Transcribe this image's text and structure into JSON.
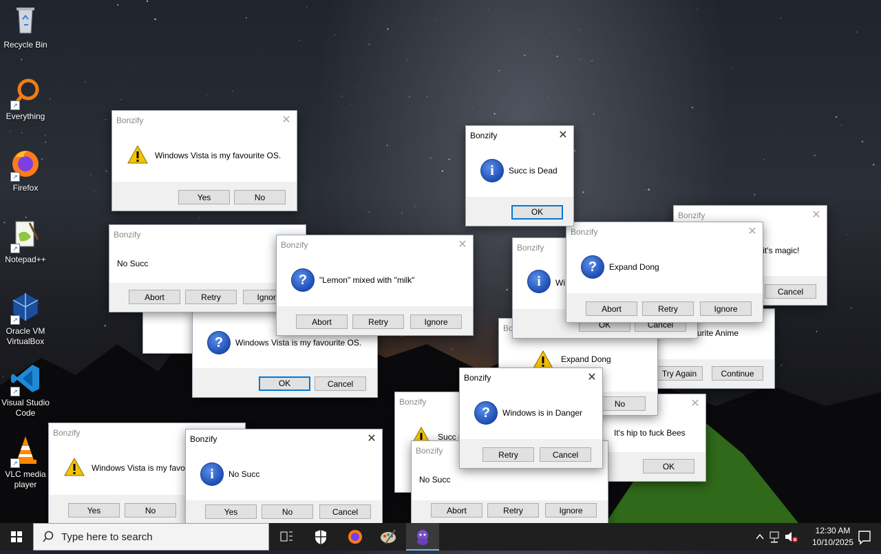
{
  "desktop_icons": [
    {
      "label": "Recycle Bin"
    },
    {
      "label": "Everything"
    },
    {
      "label": "Firefox"
    },
    {
      "label": "Notepad++"
    },
    {
      "label": "Oracle VM VirtualBox"
    },
    {
      "label": "Visual Studio Code"
    },
    {
      "label": "VLC media player"
    }
  ],
  "dialogs": {
    "app_title": "Bonzify",
    "d1": {
      "message": "Windows Vista is my favourite OS.",
      "buttons": [
        "Yes",
        "No"
      ]
    },
    "d2": {
      "message": "Succ is Dead",
      "buttons": [
        "OK"
      ]
    },
    "d3": {
      "message": "l, it's magic!",
      "buttons": [
        "Cancel"
      ]
    },
    "d4": {
      "message": "No Succ",
      "buttons": [
        "Abort",
        "Retry",
        "Ignore"
      ]
    },
    "d5": {
      "message": "\"Lemon\" mixed with \"milk\"",
      "buttons": [
        "Abort",
        "Retry",
        "Ignore"
      ]
    },
    "d6": {
      "message": "Wi",
      "buttons": [
        "OK",
        "Cancel"
      ]
    },
    "d7": {
      "message": "Expand Dong",
      "buttons": [
        "Abort",
        "Retry",
        "Ignore"
      ]
    },
    "d8": {
      "message": "Windows Vista is my favourite OS.",
      "buttons": [
        "OK",
        "Cancel"
      ]
    },
    "d9": {
      "message": "urite Anime",
      "buttons": [
        "Try Again",
        "Continue"
      ]
    },
    "d10": {
      "message": "Expand Dong",
      "buttons": [
        "No"
      ],
      "title_partial": "Bo"
    },
    "d11": {
      "message": "Windows is in Danger",
      "buttons": [
        "Retry",
        "Cancel"
      ]
    },
    "d12": {
      "message": "Succ is",
      "buttons": []
    },
    "d13": {
      "message": "It's hip to fuck Bees",
      "buttons": [
        "OK"
      ]
    },
    "d14": {
      "message": "Windows Vista is my favou",
      "buttons": [
        "Yes",
        "No"
      ]
    },
    "d15": {
      "message": "No Succ",
      "buttons": [
        "Yes",
        "No",
        "Cancel"
      ]
    },
    "d16": {
      "message": "No Succ",
      "buttons": [
        "Abort",
        "Retry",
        "Ignore"
      ]
    }
  },
  "taskbar": {
    "search_placeholder": "Type here to search",
    "time": "12:30 AM",
    "date": "10/10/2025"
  }
}
